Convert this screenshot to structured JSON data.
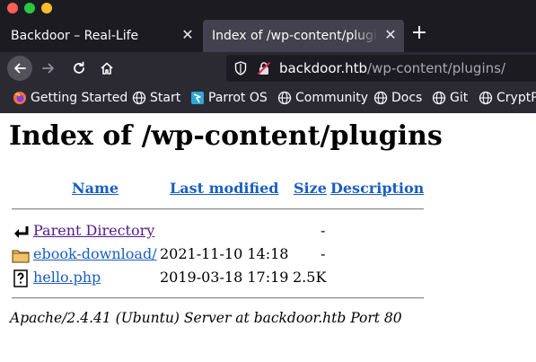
{
  "browser": {
    "tabs": [
      {
        "title": "Backdoor – Real-Life",
        "active": false
      },
      {
        "title": "Index of /wp-content/plugins",
        "active": true
      }
    ],
    "url_host": "backdoor.htb",
    "url_path": "/wp-content/plugins/",
    "bookmarks": [
      "Getting Started",
      "Start",
      "Parrot OS",
      "Community",
      "Docs",
      "Git",
      "CryptP"
    ]
  },
  "page": {
    "title": "Index of /wp-content/plugins",
    "columns": {
      "name": "Name",
      "last_modified": "Last modified",
      "size": "Size",
      "description": "Description"
    },
    "rows": [
      {
        "icon": "parent-directory-icon",
        "name": "Parent Directory",
        "last_modified": "",
        "size": "-"
      },
      {
        "icon": "folder-icon",
        "name": "ebook-download/",
        "last_modified": "2021-11-10 14:18",
        "size": "-"
      },
      {
        "icon": "unknown-file-icon",
        "name": "hello.php",
        "last_modified": "2019-03-18 17:19",
        "size": "2.5K"
      }
    ],
    "server_signature": "Apache/2.4.41 (Ubuntu) Server at backdoor.htb Port 80"
  },
  "colors": {
    "link": "#1a5ec2",
    "visited": "#551a8b",
    "toolbar": "#2b2a33",
    "tabstrip": "#1c1b22"
  }
}
